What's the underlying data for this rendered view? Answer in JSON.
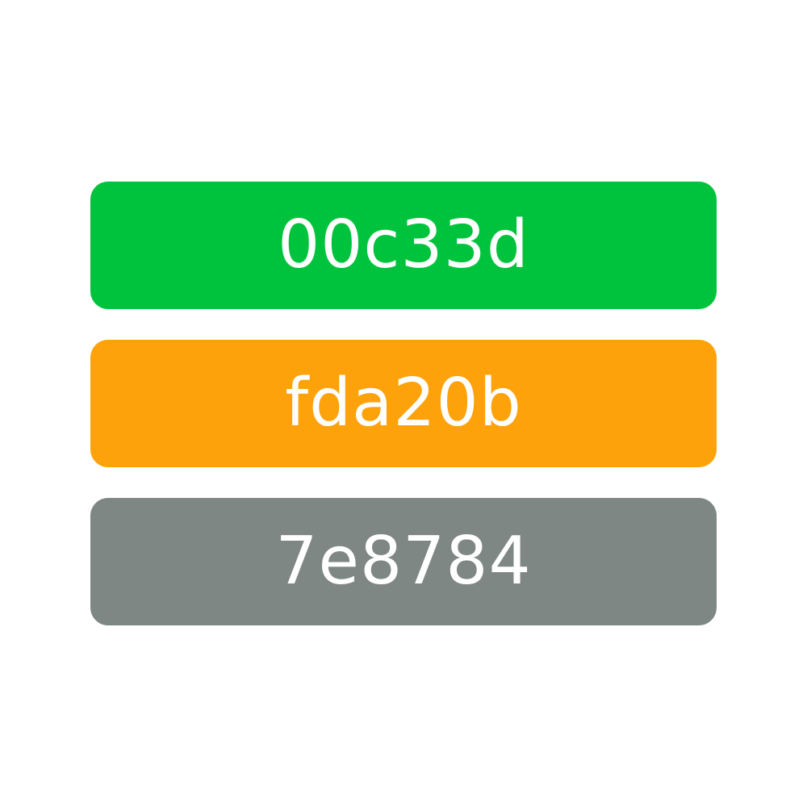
{
  "swatches": [
    {
      "label": "00c33d",
      "color": "#00c33d"
    },
    {
      "label": "fda20b",
      "color": "#fda20b"
    },
    {
      "label": "7e8784",
      "color": "#7e8784"
    }
  ]
}
